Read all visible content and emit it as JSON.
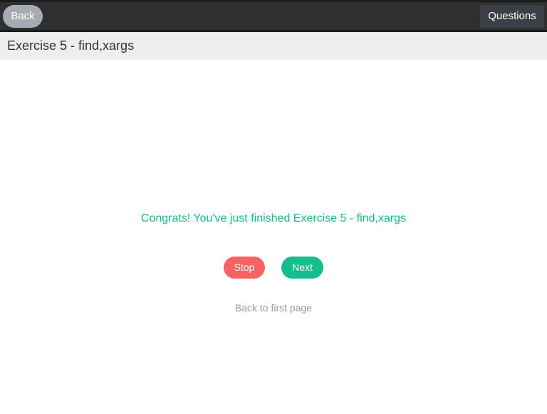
{
  "header": {
    "back_label": "Back",
    "questions_label": "Questions"
  },
  "page": {
    "title": "Exercise 5 - find,xargs"
  },
  "result": {
    "message": "Congrats! You've just finished Exercise 5 - find,xargs",
    "stop_label": "Stop",
    "next_label": "Next",
    "first_page_label": "Back to first page"
  },
  "colors": {
    "accent_green": "#16be8e",
    "stop_red": "#f76262",
    "topbar": "#2f2f2f"
  }
}
